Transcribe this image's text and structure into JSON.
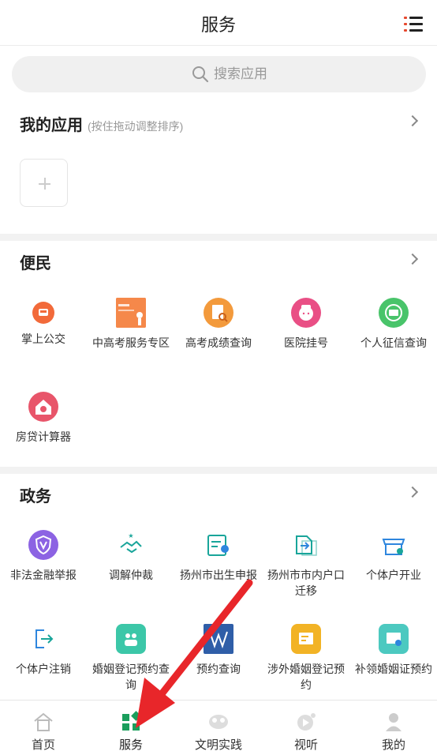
{
  "header": {
    "title": "服务"
  },
  "search": {
    "placeholder": "搜索应用"
  },
  "my_apps": {
    "title": "我的应用",
    "hint": "(按住拖动调整排序)"
  },
  "sections": {
    "bianmin": {
      "title": "便民",
      "items": [
        {
          "label": "掌上公交",
          "icon": "bus-icon",
          "color": "#f26a3a"
        },
        {
          "label": "中高考服务专区",
          "icon": "exam-banner-icon",
          "color": "#f5884a"
        },
        {
          "label": "高考成绩查询",
          "icon": "score-search-icon",
          "color": "#f39a3c"
        },
        {
          "label": "医院挂号",
          "icon": "nurse-icon",
          "color": "#e94f85"
        },
        {
          "label": "个人征信查询",
          "icon": "credit-icon",
          "color": "#49c46a"
        },
        {
          "label": "房贷计算器",
          "icon": "house-loan-icon",
          "color": "#e8556a"
        }
      ]
    },
    "zhengwu": {
      "title": "政务",
      "items": [
        {
          "label": "非法金融举报",
          "icon": "shield-report-icon",
          "color": "#8c63e3"
        },
        {
          "label": "调解仲裁",
          "icon": "handshake-icon",
          "color": "#19a59a"
        },
        {
          "label": "扬州市出生申报",
          "icon": "birth-register-icon",
          "color": "#19a59a"
        },
        {
          "label": "扬州市市内户口迁移",
          "icon": "transfer-icon",
          "color": "#19a59a"
        },
        {
          "label": "个体户开业",
          "icon": "shop-icon",
          "color": "#2e86de"
        },
        {
          "label": "个体户注销",
          "icon": "logout-icon",
          "color": "#2e86de"
        },
        {
          "label": "婚姻登记预约查询",
          "icon": "couple-icon",
          "color": "#3cc7a8"
        },
        {
          "label": "预约查询",
          "icon": "appointment-icon",
          "color": "#2f5ea8"
        },
        {
          "label": "涉外婚姻登记预约",
          "icon": "certificate-icon",
          "color": "#f2b325"
        },
        {
          "label": "补领婚姻证预约",
          "icon": "reissue-icon",
          "color": "#4cc9c0"
        }
      ]
    }
  },
  "tabbar": [
    {
      "label": "首页",
      "icon": "home-icon"
    },
    {
      "label": "服务",
      "icon": "services-icon"
    },
    {
      "label": "文明实践",
      "icon": "civilization-icon"
    },
    {
      "label": "视听",
      "icon": "video-icon"
    },
    {
      "label": "我的",
      "icon": "profile-icon"
    }
  ],
  "colors": {
    "accent_green": "#1a9e5c",
    "arrow_red": "#e8262a"
  }
}
